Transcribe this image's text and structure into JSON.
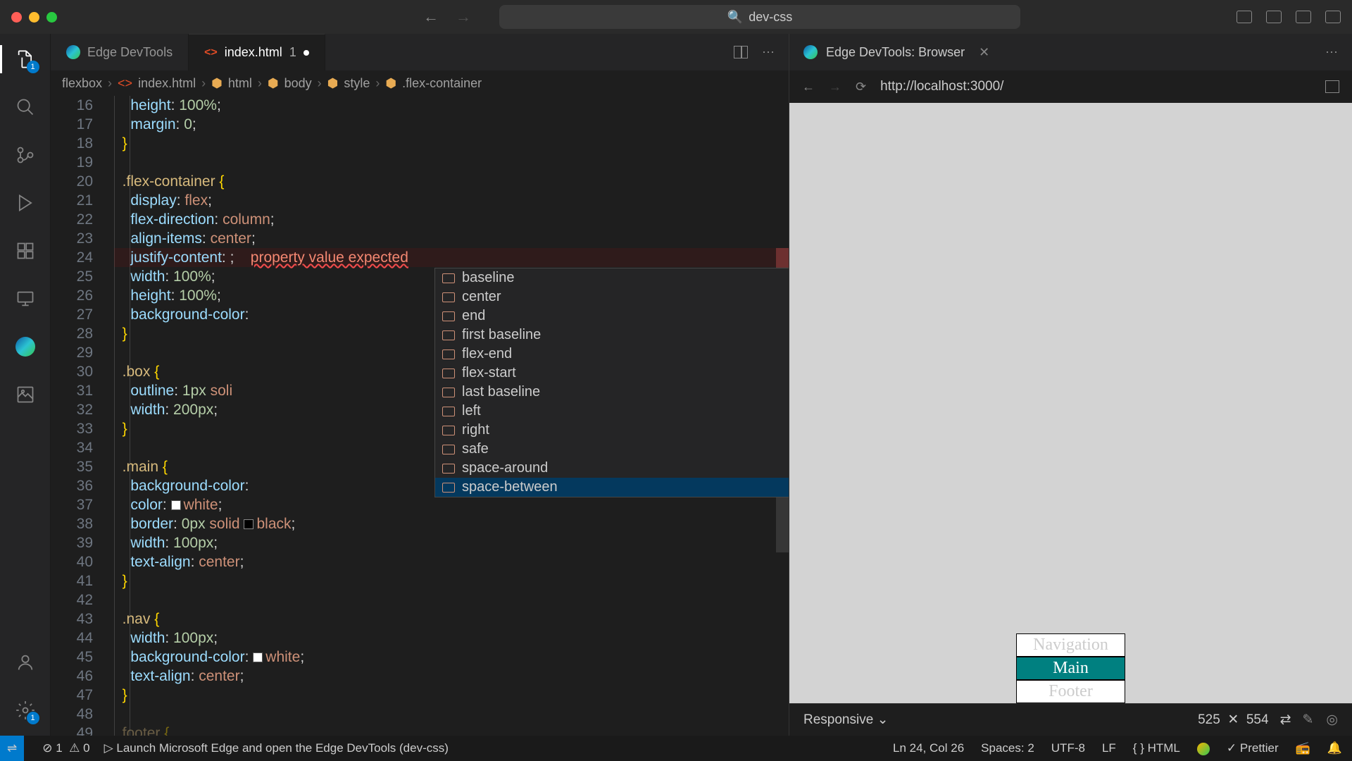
{
  "titlebar": {
    "search": "dev-css"
  },
  "activity": {
    "explorer_badge": "1",
    "settings_badge": "1"
  },
  "tabs": {
    "devtools": "Edge DevTools",
    "file": "index.html",
    "file_count": "1"
  },
  "breadcrumb": [
    "flexbox",
    "index.html",
    "html",
    "body",
    "style",
    ".flex-container"
  ],
  "gutter_start": 16,
  "code": {
    "l16": [
      "height",
      "100%"
    ],
    "l17": [
      "margin",
      "0"
    ],
    "l20_sel": ".flex-container",
    "l21": [
      "display",
      "flex"
    ],
    "l22": [
      "flex-direction",
      "column"
    ],
    "l23": [
      "align-items",
      "center"
    ],
    "l24_prop": "justify-content",
    "l24_err": "property value expected",
    "l25": [
      "width",
      "100%"
    ],
    "l26": [
      "height",
      "100%"
    ],
    "l27_prop": "background-color",
    "l30_sel": ".box",
    "l31": [
      "outline",
      "1px",
      "soli"
    ],
    "l32": [
      "width",
      "200px"
    ],
    "l35_sel": ".main",
    "l36_prop": "background-color",
    "l37": [
      "color",
      "white"
    ],
    "l38": [
      "border",
      "0px",
      "solid",
      "black"
    ],
    "l39": [
      "width",
      "100px"
    ],
    "l40": [
      "text-align",
      "center"
    ],
    "l43_sel": ".nav",
    "l44": [
      "width",
      "100px"
    ],
    "l45": [
      "background-color",
      "white"
    ],
    "l46": [
      "text-align",
      "center"
    ],
    "l49_sel": "footer"
  },
  "autocomplete": [
    "baseline",
    "center",
    "end",
    "first baseline",
    "flex-end",
    "flex-start",
    "last baseline",
    "left",
    "right",
    "safe",
    "space-around",
    "space-between"
  ],
  "browser": {
    "tab_title": "Edge DevTools: Browser",
    "url": "http://localhost:3000/",
    "preview": {
      "nav": "Navigation",
      "main": "Main",
      "footer": "Footer"
    },
    "responsive": "Responsive",
    "width": "525",
    "height": "554"
  },
  "status": {
    "errors": "1",
    "warnings": "0",
    "launch": "Launch Microsoft Edge and open the Edge DevTools (dev-css)",
    "cursor": "Ln 24, Col 26",
    "spaces": "Spaces: 2",
    "encoding": "UTF-8",
    "eol": "LF",
    "lang": "HTML",
    "prettier": "Prettier"
  }
}
